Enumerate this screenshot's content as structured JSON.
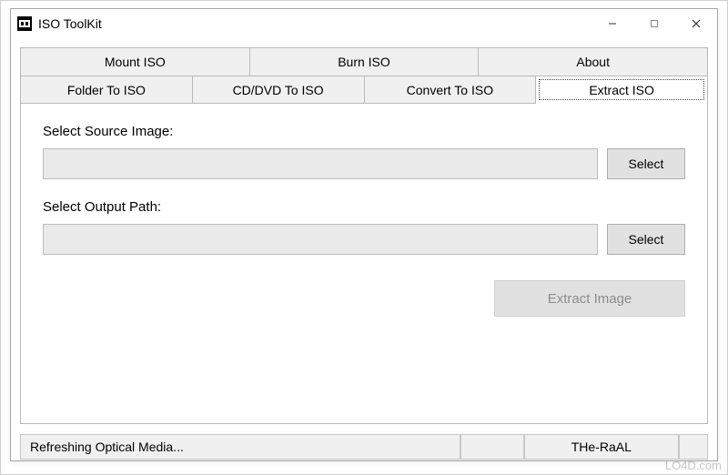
{
  "window": {
    "title": "ISO ToolKit"
  },
  "tabs": {
    "upper": [
      {
        "label": "Mount ISO"
      },
      {
        "label": "Burn ISO"
      },
      {
        "label": "About"
      }
    ],
    "lower": [
      {
        "label": "Folder To ISO"
      },
      {
        "label": "CD/DVD To ISO"
      },
      {
        "label": "Convert To ISO"
      },
      {
        "label": "Extract ISO",
        "active": true
      }
    ]
  },
  "form": {
    "source_label": "Select Source Image:",
    "source_value": "",
    "source_button": "Select",
    "output_label": "Select Output Path:",
    "output_value": "",
    "output_button": "Select",
    "extract_button": "Extract Image"
  },
  "statusbar": {
    "message": "Refreshing Optical Media...",
    "author": "THe-RaAL"
  },
  "watermark": "LO4D.com"
}
